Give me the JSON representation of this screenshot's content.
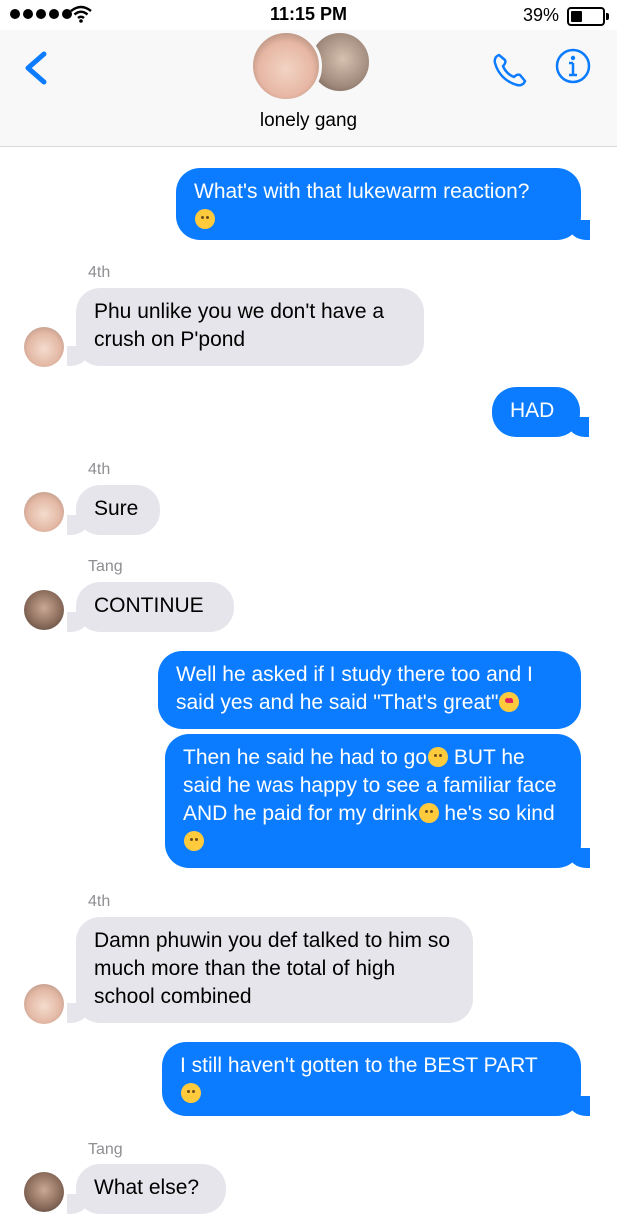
{
  "status_bar": {
    "time": "11:15 PM",
    "battery": "39%"
  },
  "header": {
    "title": "lonely gang",
    "back_icon": "chevron-left-icon",
    "call_icon": "phone-icon",
    "info_icon": "info-icon",
    "accent": "#0b7cff"
  },
  "messages": [
    {
      "dir": "out",
      "text": "What's with that lukewarm reaction?",
      "emoji": "neutral"
    },
    {
      "dir": "in",
      "sender": "4th",
      "text": "Phu unlike you we don't have a crush on P'pond"
    },
    {
      "dir": "out",
      "text": "HAD"
    },
    {
      "dir": "in",
      "sender": "4th",
      "text": "Sure"
    },
    {
      "dir": "in",
      "sender": "Tang",
      "text": "CONTINUE"
    },
    {
      "dir": "out",
      "text": "Well he asked if I study there too and I said yes and he said \"That's great\""
    },
    {
      "dir": "out",
      "text_a": "Then he said he had to go",
      "text_b": " BUT he said he was happy to see a familiar face AND he paid for my drink",
      "text_c": " he's so kind"
    },
    {
      "dir": "in",
      "sender": "4th",
      "text": "Damn phuwin you def talked to him so much more than the total of high school combined"
    },
    {
      "dir": "out",
      "text": "I still haven't gotten to the BEST PART"
    },
    {
      "dir": "in",
      "sender": "Tang",
      "text": "What else?"
    }
  ]
}
